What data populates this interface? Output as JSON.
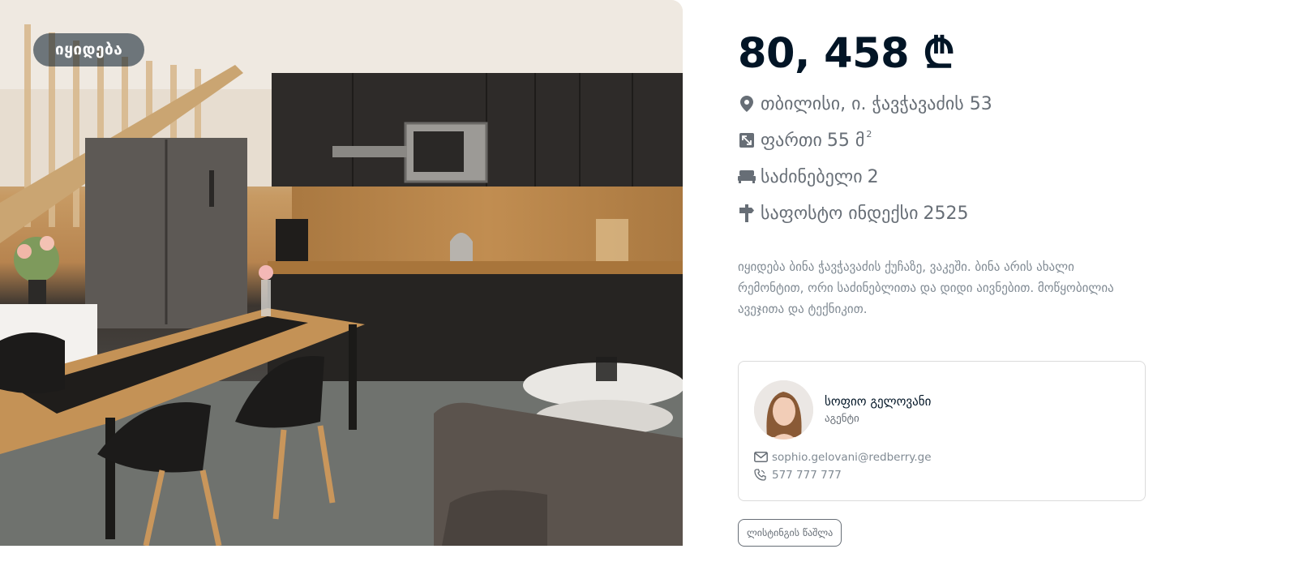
{
  "listing": {
    "badge": "იყიდება",
    "price": "80, 458 ₾",
    "address": "თბილისი, ი. ჭავჭავაძის 53",
    "area_label": "ფართი",
    "area_value": "55 მ",
    "area_unit_sup": "2",
    "bedrooms_label": "საძინებელი",
    "bedrooms_value": "2",
    "zip_label": "საფოსტო ინდექსი",
    "zip_value": "2525",
    "description": "იყიდება ბინა ჭავჭავაძის ქუჩაზე, ვაკეში. ბინა არის ახალი რემონტით, ორი საძინებლითა და დიდი აივნებით. მოწყობილია ავეჯითა და ტექნიკით.",
    "photo_icon": "apartment-interior-photo"
  },
  "agent": {
    "name": "სოფიო გელოვანი",
    "role": "აგენტი",
    "email": "sophio.gelovani@redberry.ge",
    "phone": "577 777 777",
    "email_icon": "mail-icon",
    "phone_icon": "phone-icon"
  },
  "actions": {
    "delete_label": "ლისტინგის წაშლა"
  },
  "icons": {
    "address": "location-pin-icon",
    "area": "area-icon",
    "bedrooms": "bed-icon",
    "zip": "signpost-icon"
  },
  "colors": {
    "text_primary": "#021526",
    "text_secondary": "#676E76",
    "text_muted": "#808A93",
    "border": "#DBDBDB",
    "badge_bg": "rgba(2,21,38,0.55)"
  }
}
